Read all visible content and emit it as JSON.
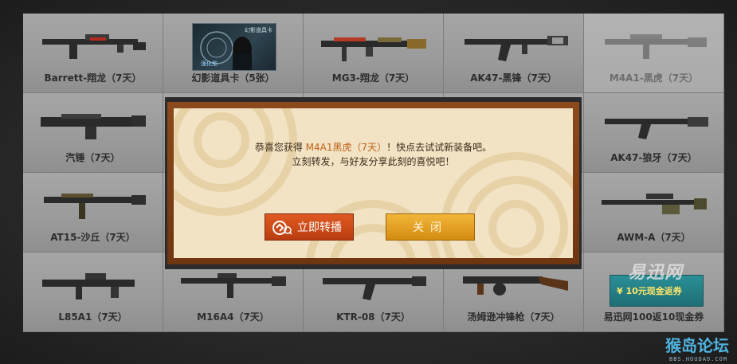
{
  "items": [
    {
      "label": "Barrett-翔龙（7天）",
      "icon": "sniper-rifle-icon"
    },
    {
      "label": "幻影道具卡（5张）",
      "icon": "item-card-icon",
      "card_tag": "幻影道具卡",
      "card_sub": "强化型"
    },
    {
      "label": "MG3-翔龙（7天）",
      "icon": "machine-gun-icon"
    },
    {
      "label": "AK47-黑锋（7天）",
      "icon": "assault-rifle-icon"
    },
    {
      "label": "M4A1-黑虎（7天）",
      "icon": "assault-rifle-icon"
    },
    {
      "label": "汽锤（7天）",
      "icon": "shotgun-icon"
    },
    {
      "label": "AK47-狼牙（7天）",
      "icon": "assault-rifle-icon"
    },
    {
      "label": "AT15-沙丘（7天）",
      "icon": "assault-rifle-icon"
    },
    {
      "label": "AWM-A（7天）",
      "icon": "sniper-rifle-icon"
    },
    {
      "label": "L85A1（7天）",
      "icon": "bullpup-rifle-icon"
    },
    {
      "label": "M16A4（7天）",
      "icon": "assault-rifle-icon"
    },
    {
      "label": "KTR-08（7天）",
      "icon": "assault-rifle-icon"
    },
    {
      "label": "汤姆逊冲锋枪（7天）",
      "icon": "submachine-gun-icon"
    },
    {
      "label": "易迅网100返10现金券",
      "icon": "coupon-icon",
      "coupon_text": "¥ 10元现金返券"
    }
  ],
  "brand_watermark": "易迅网",
  "modal": {
    "line1_prefix": "恭喜您获得 ",
    "line1_item": "M4A1黑虎（7天）",
    "line1_suffix": "！快点去试试新装备吧。",
    "line2": "立刻转发，与好友分享此刻的喜悦吧！",
    "share_label": "立即转播",
    "close_label": "关闭"
  },
  "footer": {
    "logo": "猴岛论坛",
    "url": "BBS.HOUDAO.COM"
  },
  "colors": {
    "highlight": "#c0601a",
    "share_button": "#d04a18",
    "close_button": "#e6a428"
  }
}
